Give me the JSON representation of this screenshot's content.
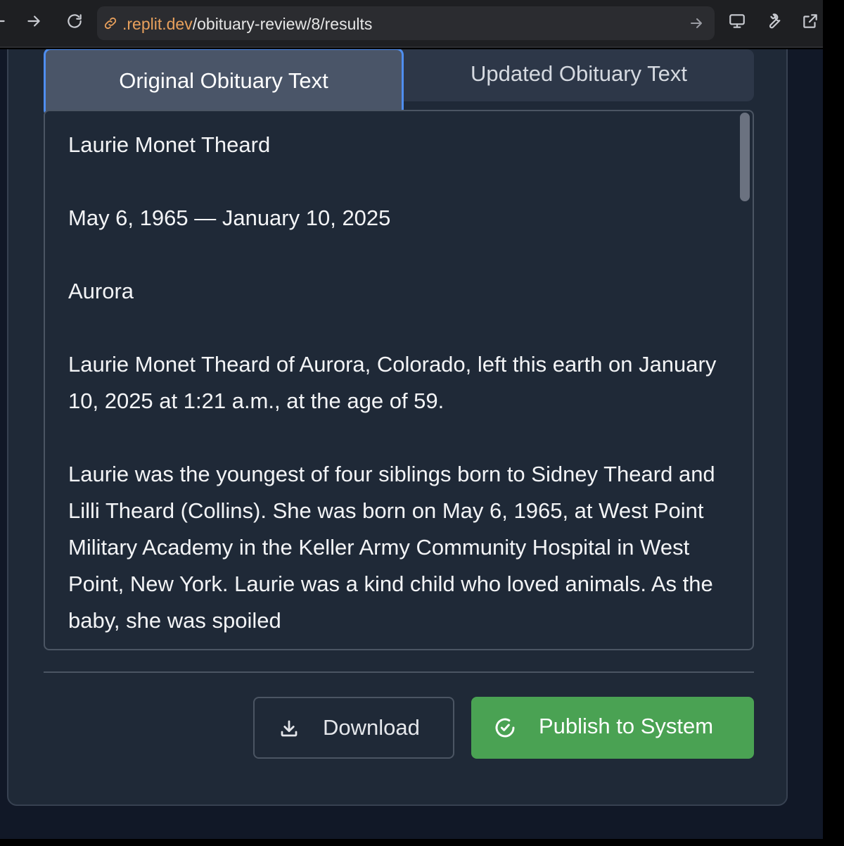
{
  "browser": {
    "url_domain": ".replit.dev",
    "url_path": "/obituary-review/8/results"
  },
  "tabs": [
    {
      "label": "Original Obituary Text",
      "active": true
    },
    {
      "label": "Updated Obituary Text",
      "active": false
    }
  ],
  "obituary": {
    "paragraphs": [
      "Laurie Monet Theard",
      "May 6, 1965 — January 10, 2025",
      "Aurora",
      "Laurie Monet Theard of Aurora, Colorado, left this earth on January 10, 2025 at 1:21 a.m., at the age of 59.",
      "Laurie was the youngest of four siblings born to Sidney Theard and Lilli Theard (Collins). She was born on May 6, 1965, at West Point Military Academy in the Keller Army Community Hospital in West Point, New York. Laurie was a kind child who loved animals. As the baby, she was spoiled"
    ]
  },
  "actions": {
    "download_label": "Download",
    "publish_label": "Publish to System"
  },
  "colors": {
    "accent_tab_border": "#4f8ef0",
    "publish_button": "#4aa253",
    "url_domain": "#e8a05c"
  }
}
